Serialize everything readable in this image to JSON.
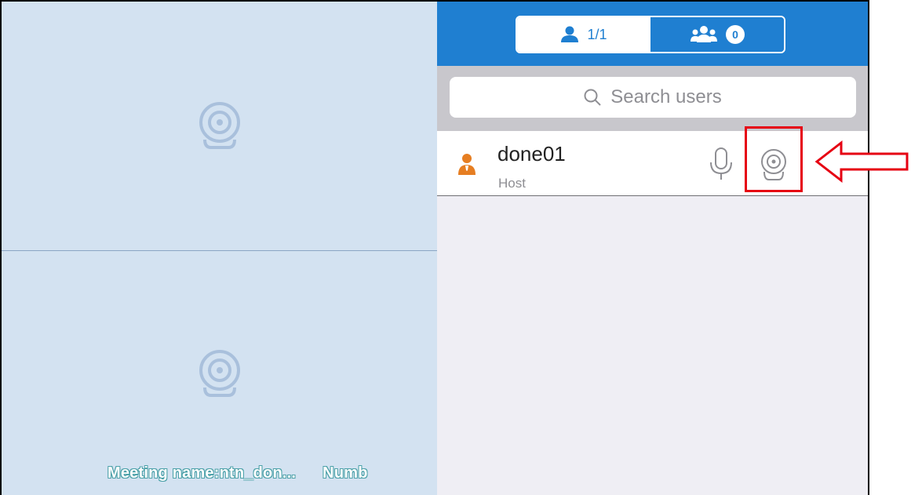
{
  "video": {
    "meeting_info": "Meeting name:ntn_don...",
    "number_label": "Numb"
  },
  "panel": {
    "tabs": [
      {
        "label": "1/1",
        "icon": "single-user-icon",
        "active": true
      },
      {
        "label": "0",
        "icon": "group-users-icon",
        "active": false
      }
    ],
    "search": {
      "placeholder": "Search users"
    },
    "users": [
      {
        "name": "done01",
        "role": "Host",
        "avatar": "host-person-icon"
      }
    ]
  },
  "colors": {
    "header": "#1f7fd1",
    "video_bg": "#d3e2f1",
    "host_orange": "#e67e22",
    "annotation_red": "#e60012"
  }
}
